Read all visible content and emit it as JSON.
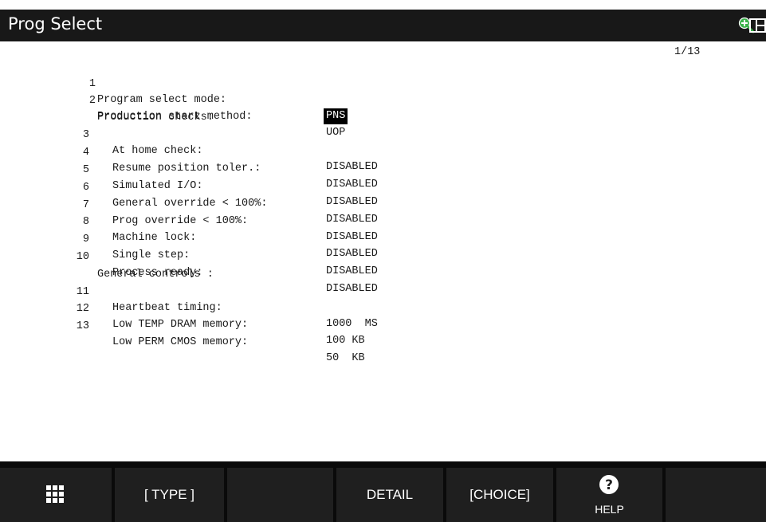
{
  "window": {
    "title": "Prog Select"
  },
  "icons": {
    "zoom": "zoom-in-icon",
    "split": "split-screen-icon",
    "menu": "grid-menu-icon",
    "help": "help-question-icon"
  },
  "colors": {
    "titlebar": "#181818",
    "zoom_accent": "#3bb34a",
    "selection": "#000000",
    "function_bar": "#1f1f1f"
  },
  "page": {
    "indicator": "1/13"
  },
  "rows": [
    {
      "num": "1",
      "label": "Program select mode:",
      "value": "PNS"
    },
    {
      "num": "2",
      "label": "Production start method:",
      "value": "UOP"
    },
    {
      "num": "",
      "label": "Production checks:",
      "value": ""
    },
    {
      "num": "3",
      "label": "At home check:",
      "value": "DISABLED"
    },
    {
      "num": "4",
      "label": "Resume position toler.:",
      "value": "DISABLED"
    },
    {
      "num": "5",
      "label": "Simulated I/O:",
      "value": "DISABLED"
    },
    {
      "num": "6",
      "label": "General override < 100%:",
      "value": "DISABLED"
    },
    {
      "num": "7",
      "label": "Prog override < 100%:",
      "value": "DISABLED"
    },
    {
      "num": "8",
      "label": "Machine lock:",
      "value": "DISABLED"
    },
    {
      "num": "9",
      "label": "Single step:",
      "value": "DISABLED"
    },
    {
      "num": "10",
      "label": "Process ready:",
      "value": "DISABLED"
    },
    {
      "num": "",
      "label": "General controls :",
      "value": ""
    },
    {
      "num": "11",
      "label": "Heartbeat timing:",
      "value": "1000  MS"
    },
    {
      "num": "12",
      "label": "Low TEMP DRAM memory:",
      "value": "100 KB"
    },
    {
      "num": "13",
      "label": "Low PERM CMOS memory:",
      "value": "50  KB"
    }
  ],
  "function_keys": {
    "type": "[ TYPE ]",
    "f2": "",
    "detail": "DETAIL",
    "choice": "[CHOICE]",
    "help": "HELP",
    "f5": ""
  }
}
